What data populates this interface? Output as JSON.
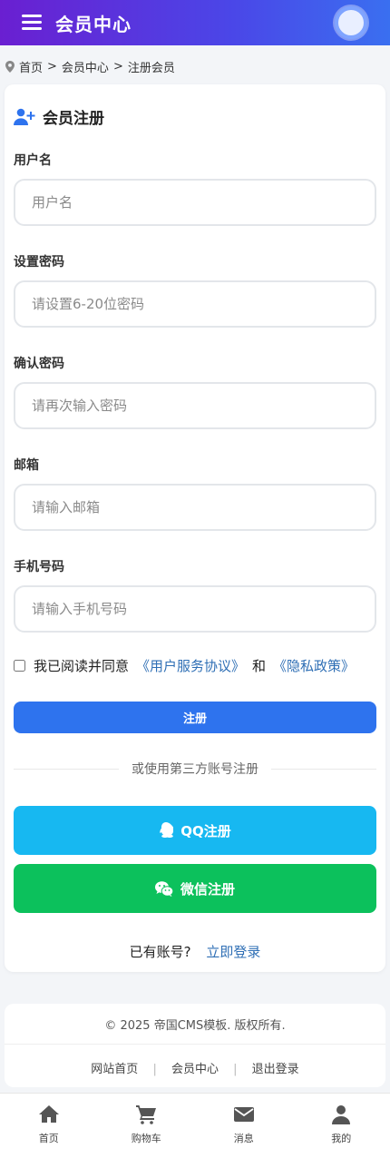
{
  "header": {
    "title": "会员中心"
  },
  "breadcrumb": {
    "home": "首页",
    "sep": ">",
    "member": "会员中心",
    "current": "注册会员"
  },
  "form": {
    "title": "会员注册",
    "fields": [
      {
        "label": "用户名",
        "placeholder": "用户名"
      },
      {
        "label": "设置密码",
        "placeholder": "请设置6-20位密码"
      },
      {
        "label": "确认密码",
        "placeholder": "请再次输入密码"
      },
      {
        "label": "邮箱",
        "placeholder": "请输入邮箱"
      },
      {
        "label": "手机号码",
        "placeholder": "请输入手机号码"
      }
    ],
    "agree_text": "我已阅读并同意",
    "agree_link1": "《用户服务协议》",
    "agree_and": "和",
    "agree_link2": "《隐私政策》",
    "register_label": "注册",
    "divider_text": "或使用第三方账号注册",
    "qq_label": "QQ注册",
    "wechat_label": "微信注册",
    "have_account": "已有账号?",
    "login_link": "立即登录"
  },
  "footer": {
    "copyright": "© 2025 帝国CMS模板. 版权所有.",
    "links": [
      "网站首页",
      "会员中心",
      "退出登录"
    ],
    "sep": "|"
  },
  "tabbar": {
    "items": [
      {
        "label": "首页",
        "icon": "home-icon"
      },
      {
        "label": "购物车",
        "icon": "cart-icon"
      },
      {
        "label": "消息",
        "icon": "envelope-icon"
      },
      {
        "label": "我的",
        "icon": "user-icon"
      }
    ]
  },
  "colors": {
    "primary": "#2e73ee",
    "qq": "#17b8f1",
    "wechat": "#0cc15c",
    "link": "#2f6fb5"
  }
}
